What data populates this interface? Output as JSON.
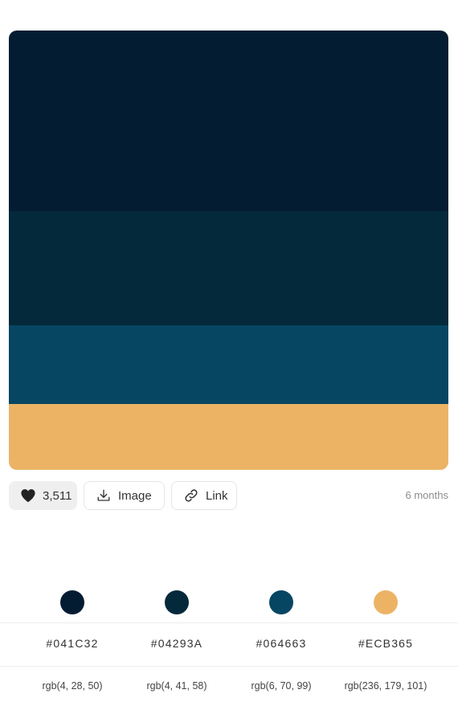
{
  "palette": {
    "colors": [
      {
        "hex": "#041C32",
        "rgb": "rgb(4, 28, 50)",
        "color": "#041C32"
      },
      {
        "hex": "#04293A",
        "rgb": "rgb(4, 41, 58)",
        "color": "#04293A"
      },
      {
        "hex": "#064663",
        "rgb": "rgb(6, 70, 99)",
        "color": "#064663"
      },
      {
        "hex": "#ECB365",
        "rgb": "rgb(236, 179, 101)",
        "color": "#ECB365"
      }
    ]
  },
  "actions": {
    "like_count": "3,511",
    "like_icon": "heart-icon",
    "image_label": "Image",
    "image_icon": "download-icon",
    "link_label": "Link",
    "link_icon": "link-icon",
    "time_ago": "6 months"
  }
}
